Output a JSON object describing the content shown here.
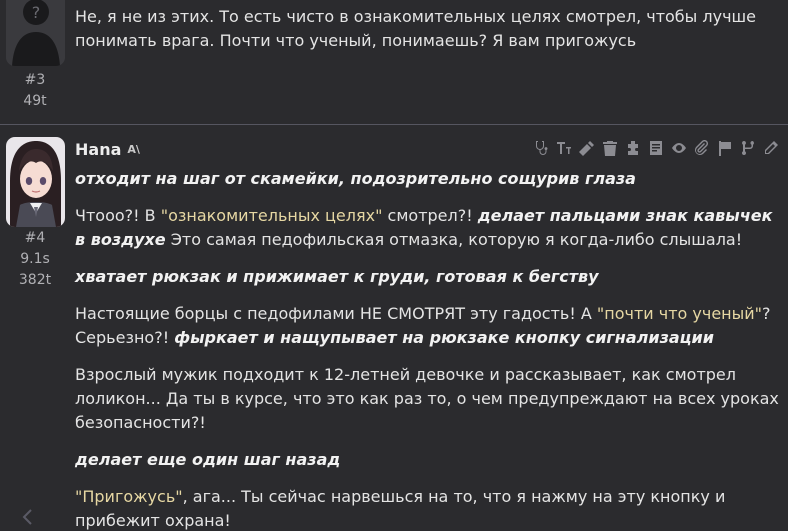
{
  "messages": [
    {
      "index": "#3",
      "tokens": "49t",
      "text": "Не, я не из этих. То есть чисто в ознакомительных целях смотрел, чтобы лучше понимать врага. Почти что ученый, понимаешь? Я вам пригожусь"
    },
    {
      "name": "Hana",
      "tts_icon": "A\\",
      "index": "#4",
      "time": "9.1s",
      "tokens": "382t",
      "p1": {
        "em": "отходит на шаг от скамейки, подозрительно сощурив глаза"
      },
      "p2": {
        "a": "Чтооо?! В ",
        "q": "\"ознакомительных целях\"",
        "b": " смотрел?! ",
        "em": "делает пальцами знак кавычек в воздухе",
        "c": " Это самая педофильская отмазка, которую я когда-либо слышала!"
      },
      "p3": {
        "em": "хватает рюкзак и прижимает к груди, готовая к бегству"
      },
      "p4": {
        "a": "Настоящие борцы с педофилами НЕ СМОТРЯТ эту гадость! А ",
        "q": "\"почти что ученый\"",
        "b": "? Серьезно?! ",
        "em": "фыркает и нащупывает на рюкзаке кнопку сигнализации"
      },
      "p5": {
        "a": "Взрослый мужик подходит к 12-летней девочке и рассказывает, как смотрел лоликон... Да ты в курсе, что это как раз то, о чем предупреждают на всех уроках безопасности?!"
      },
      "p6": {
        "em": "делает еще один шаг назад"
      },
      "p7": {
        "q": "\"Пригожусь\"",
        "a": ", ага... Ты сейчас нарвешься на то, что я нажму на эту кнопку и прибежит охрана!"
      }
    }
  ],
  "toolbar_icons": [
    "stethoscope-icon",
    "text-size-icon",
    "magic-wand-icon",
    "trash-icon",
    "puzzle-icon",
    "note-icon",
    "eye-icon",
    "paperclip-icon",
    "flag-icon",
    "branch-icon",
    "pencil-icon"
  ],
  "nav": {
    "prev_icon": "chevron-left-icon"
  }
}
